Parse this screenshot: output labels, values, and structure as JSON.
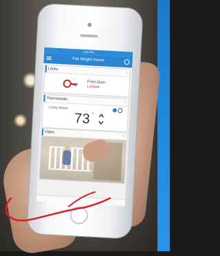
{
  "app": {
    "title": "The Wright Home",
    "statusbar": "9:51 PM"
  },
  "locks": {
    "header": "Locks",
    "device_name": "Front Door",
    "state": "Locked"
  },
  "thermostats": {
    "header": "Thermostats",
    "room": "Living Room",
    "temperature": "73",
    "unit": "°"
  },
  "video": {
    "header": "Video"
  },
  "colors": {
    "nav_blue": "#2a86d2",
    "locked_red": "#c62828"
  },
  "icons": {
    "menu": "menu-icon",
    "refresh": "refresh-icon",
    "key": "key-icon",
    "chevron": "chevron-right-icon",
    "arrows": "up-down-arrow-icon",
    "mode": "snowflake-gear-icon"
  }
}
